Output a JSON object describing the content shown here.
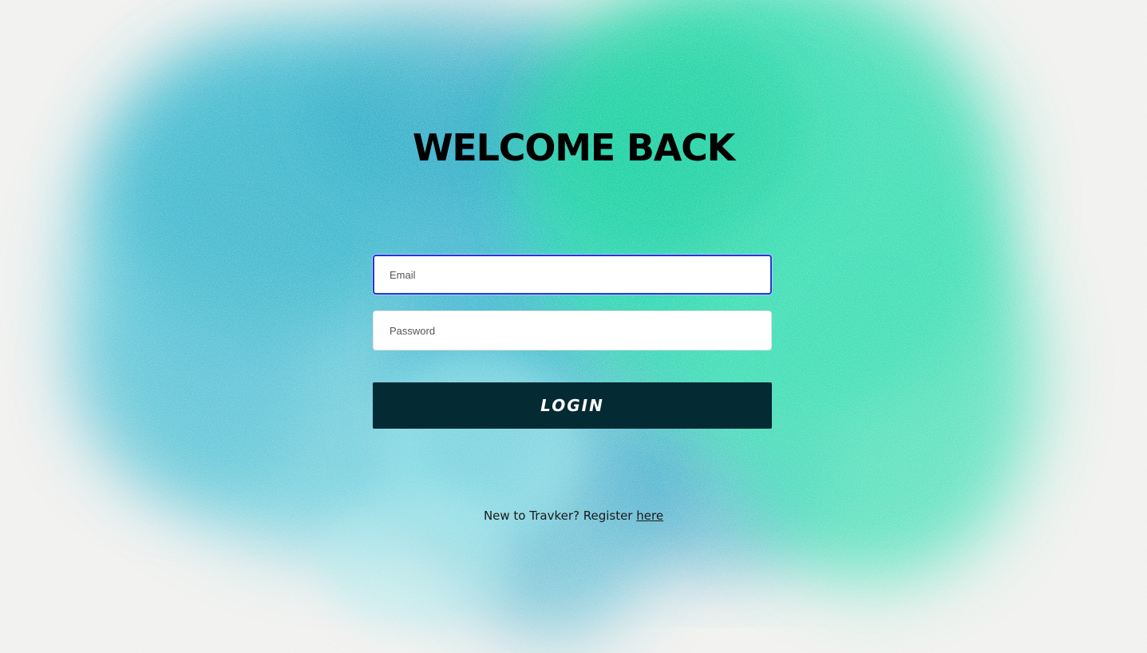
{
  "page": {
    "title": "WELCOME BACK"
  },
  "form": {
    "email_placeholder": "Email",
    "password_placeholder": "Password",
    "login_label": "LOGIN"
  },
  "footer": {
    "register_prefix": "New to Travker? Register ",
    "register_link": "here"
  },
  "colors": {
    "button_bg": "#042a33",
    "focus_border": "#1a3ecf",
    "watercolor_teal": "#3fc3d6",
    "watercolor_green": "#25dba8"
  }
}
